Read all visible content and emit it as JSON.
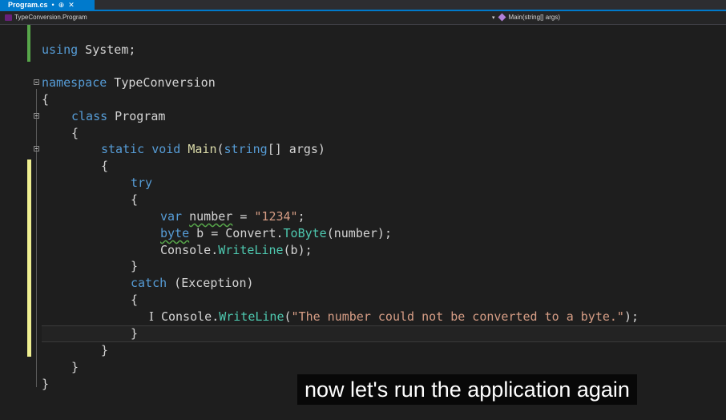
{
  "tab": {
    "title": "Program.cs",
    "modified_glyph": "•",
    "pin_glyph": "⊕",
    "close_glyph": "✕"
  },
  "navbar": {
    "left_label": "TypeConversion.Program",
    "right_label": "Main(string[] args)"
  },
  "code": {
    "line_using": [
      "using",
      " System;"
    ],
    "line_namespace": [
      "namespace",
      " TypeConversion"
    ],
    "line_brace_ns_open": "{",
    "line_class": [
      "class",
      " Program"
    ],
    "line_brace_class_open": "{",
    "line_main": [
      "static",
      " ",
      "void",
      " ",
      "Main",
      "(",
      "string",
      "[] args)"
    ],
    "line_brace_main_open": "{",
    "line_try": "try",
    "line_brace_try_open": "{",
    "line_var": [
      "var",
      " ",
      "number",
      " = ",
      "\"1234\"",
      ";"
    ],
    "line_byte": [
      "byte",
      " b = ",
      "Convert",
      ".",
      "ToByte",
      "(number);"
    ],
    "line_console_b": [
      "Console",
      ".",
      "WriteLine",
      "(b);"
    ],
    "line_brace_try_close": "}",
    "line_catch": [
      "catch",
      " (Exception)"
    ],
    "line_brace_catch_open": "{",
    "line_console_msg": [
      "Console",
      ".",
      "WriteLine",
      "(",
      "\"The number could not be converted to a byte.\"",
      ");"
    ],
    "line_brace_catch_close": "}",
    "line_brace_main_close": "}",
    "line_brace_class_close": "}",
    "line_brace_ns_close": "}"
  },
  "caption": {
    "text": "now let's run the application again"
  },
  "colors": {
    "keyword": "#569cd6",
    "type": "#4ec9b0",
    "method": "#dcdcaa",
    "string": "#d69d85",
    "tab_accent": "#007acc"
  },
  "icons": {
    "navbar_left": "csharp-class-icon",
    "navbar_right": "method-icon"
  }
}
